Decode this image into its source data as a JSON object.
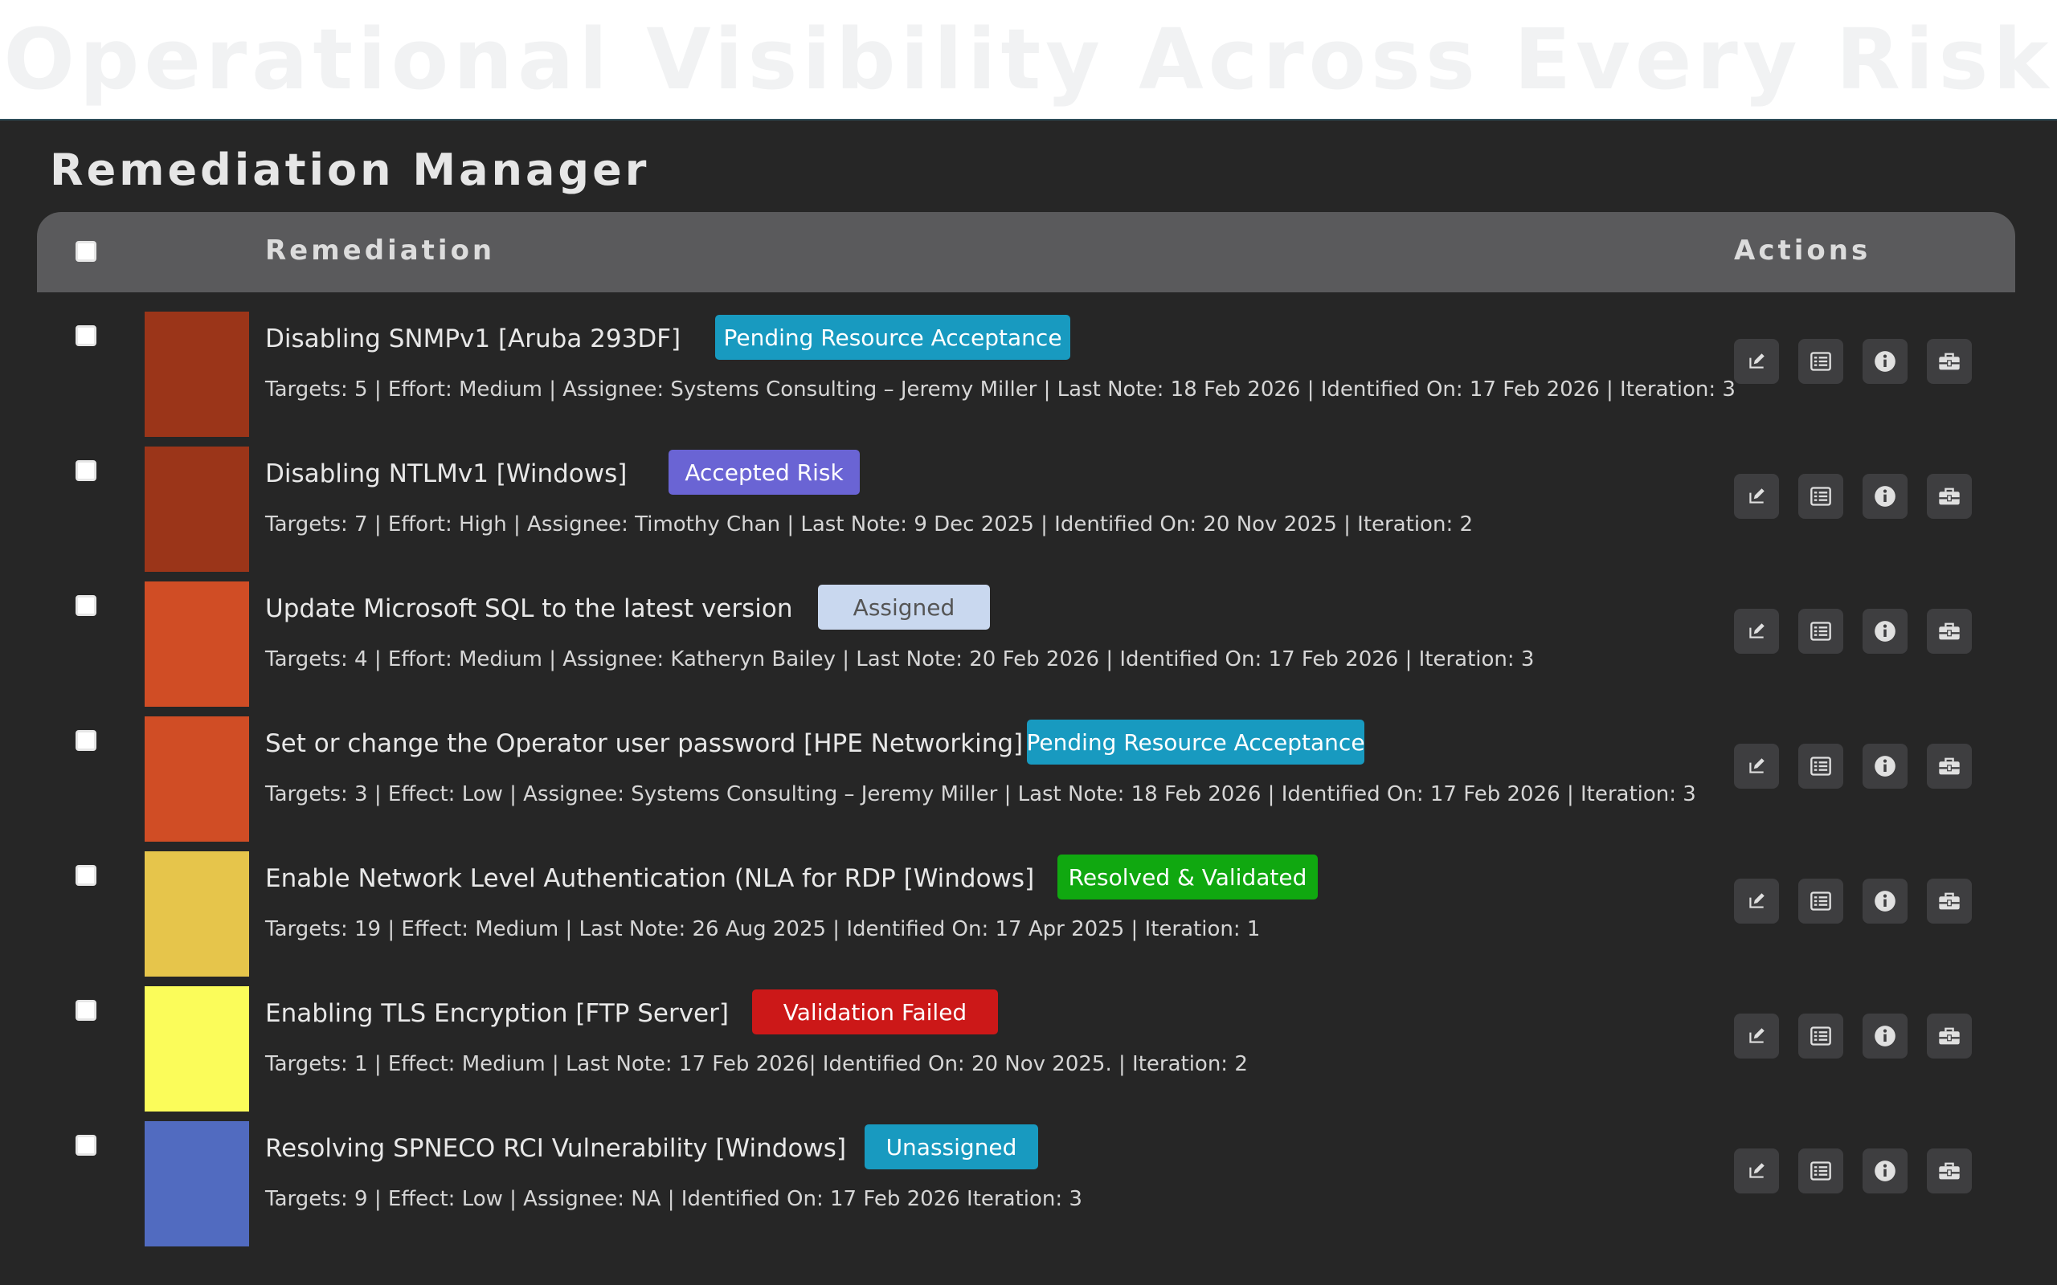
{
  "hero": {
    "title": "Operational Visibility Across Every Risk"
  },
  "panel": {
    "title": "Remediation Manager"
  },
  "table": {
    "headers": {
      "remediation": "Remediation",
      "actions": "Actions"
    }
  },
  "colors": {
    "sev_critical": "#9b3519",
    "sev_high": "#d04d25",
    "sev_medium": "#e6c54b",
    "sev_low": "#fbfc5a",
    "sev_info": "#516bc0",
    "badge_pending": "#189ac0",
    "badge_accepted": "#6a64d4",
    "badge_assigned": "#c9d8ef",
    "badge_resolved": "#10a810",
    "badge_failed": "#cc1818",
    "badge_unassigned": "#189ac0"
  },
  "action_icons": [
    "edit-icon",
    "list-icon",
    "info-icon",
    "toolbox-icon"
  ],
  "rows": [
    {
      "title": "Disabling SNMPv1 [Aruba 293DF]",
      "status": "Pending Resource Acceptance",
      "meta": "Targets:  5  |  Effort: Medium  | Assignee: Systems Consulting – Jeremy Miller |  Last Note: 18 Feb 2026 |  Identified On: 17 Feb 2026  |  Iteration:  3"
    },
    {
      "title": "Disabling NTLMv1 [Windows]",
      "status": "Accepted Risk",
      "meta": "Targets:  7  |  Effort: High  | Assignee: Timothy Chan  |  Last Note: 9 Dec 2025 |  Identified On: 20 Nov 2025  |  Iteration: 2"
    },
    {
      "title": "Update Microsoft SQL to the latest version",
      "status": "Assigned",
      "meta": "Targets:  4  |  Effort: Medium  | Assignee: Katheryn Bailey |  Last Note: 20 Feb 2026 |  Identified On: 17 Feb 2026  |  Iteration: 3"
    },
    {
      "title": "Set or change the Operator user password [HPE Networking]",
      "status": "Pending Resource Acceptance",
      "meta": "Targets:  3  |  Effect: Low  | Assignee: Systems Consulting – Jeremy Miller  |  Last Note: 18 Feb 2026  |  Identified On: 17 Feb 2026 |  Iteration: 3"
    },
    {
      "title": "Enable Network Level Authentication (NLA for RDP [Windows]",
      "status": "Resolved & Validated",
      "meta": "Targets:  19  |  Effect: Medium  | Last Note: 26 Aug 2025 |  Identified On: 17 Apr 2025  |  Iteration:  1"
    },
    {
      "title": "Enabling TLS Encryption [FTP Server]",
      "status": "Validation Failed",
      "meta": "Targets:  1  |  Effect: Medium  | Last Note: 17 Feb 2026|  Identified On: 20 Nov 2025.  |  Iteration:  2"
    },
    {
      "title": "Resolving SPNECO RCI Vulnerability [Windows]",
      "status": "Unassigned",
      "meta": "Targets:  9  |  Effect: Low  | Assignee: NA  |  Identified On: 17 Feb 2026  Iteration: 3"
    }
  ]
}
